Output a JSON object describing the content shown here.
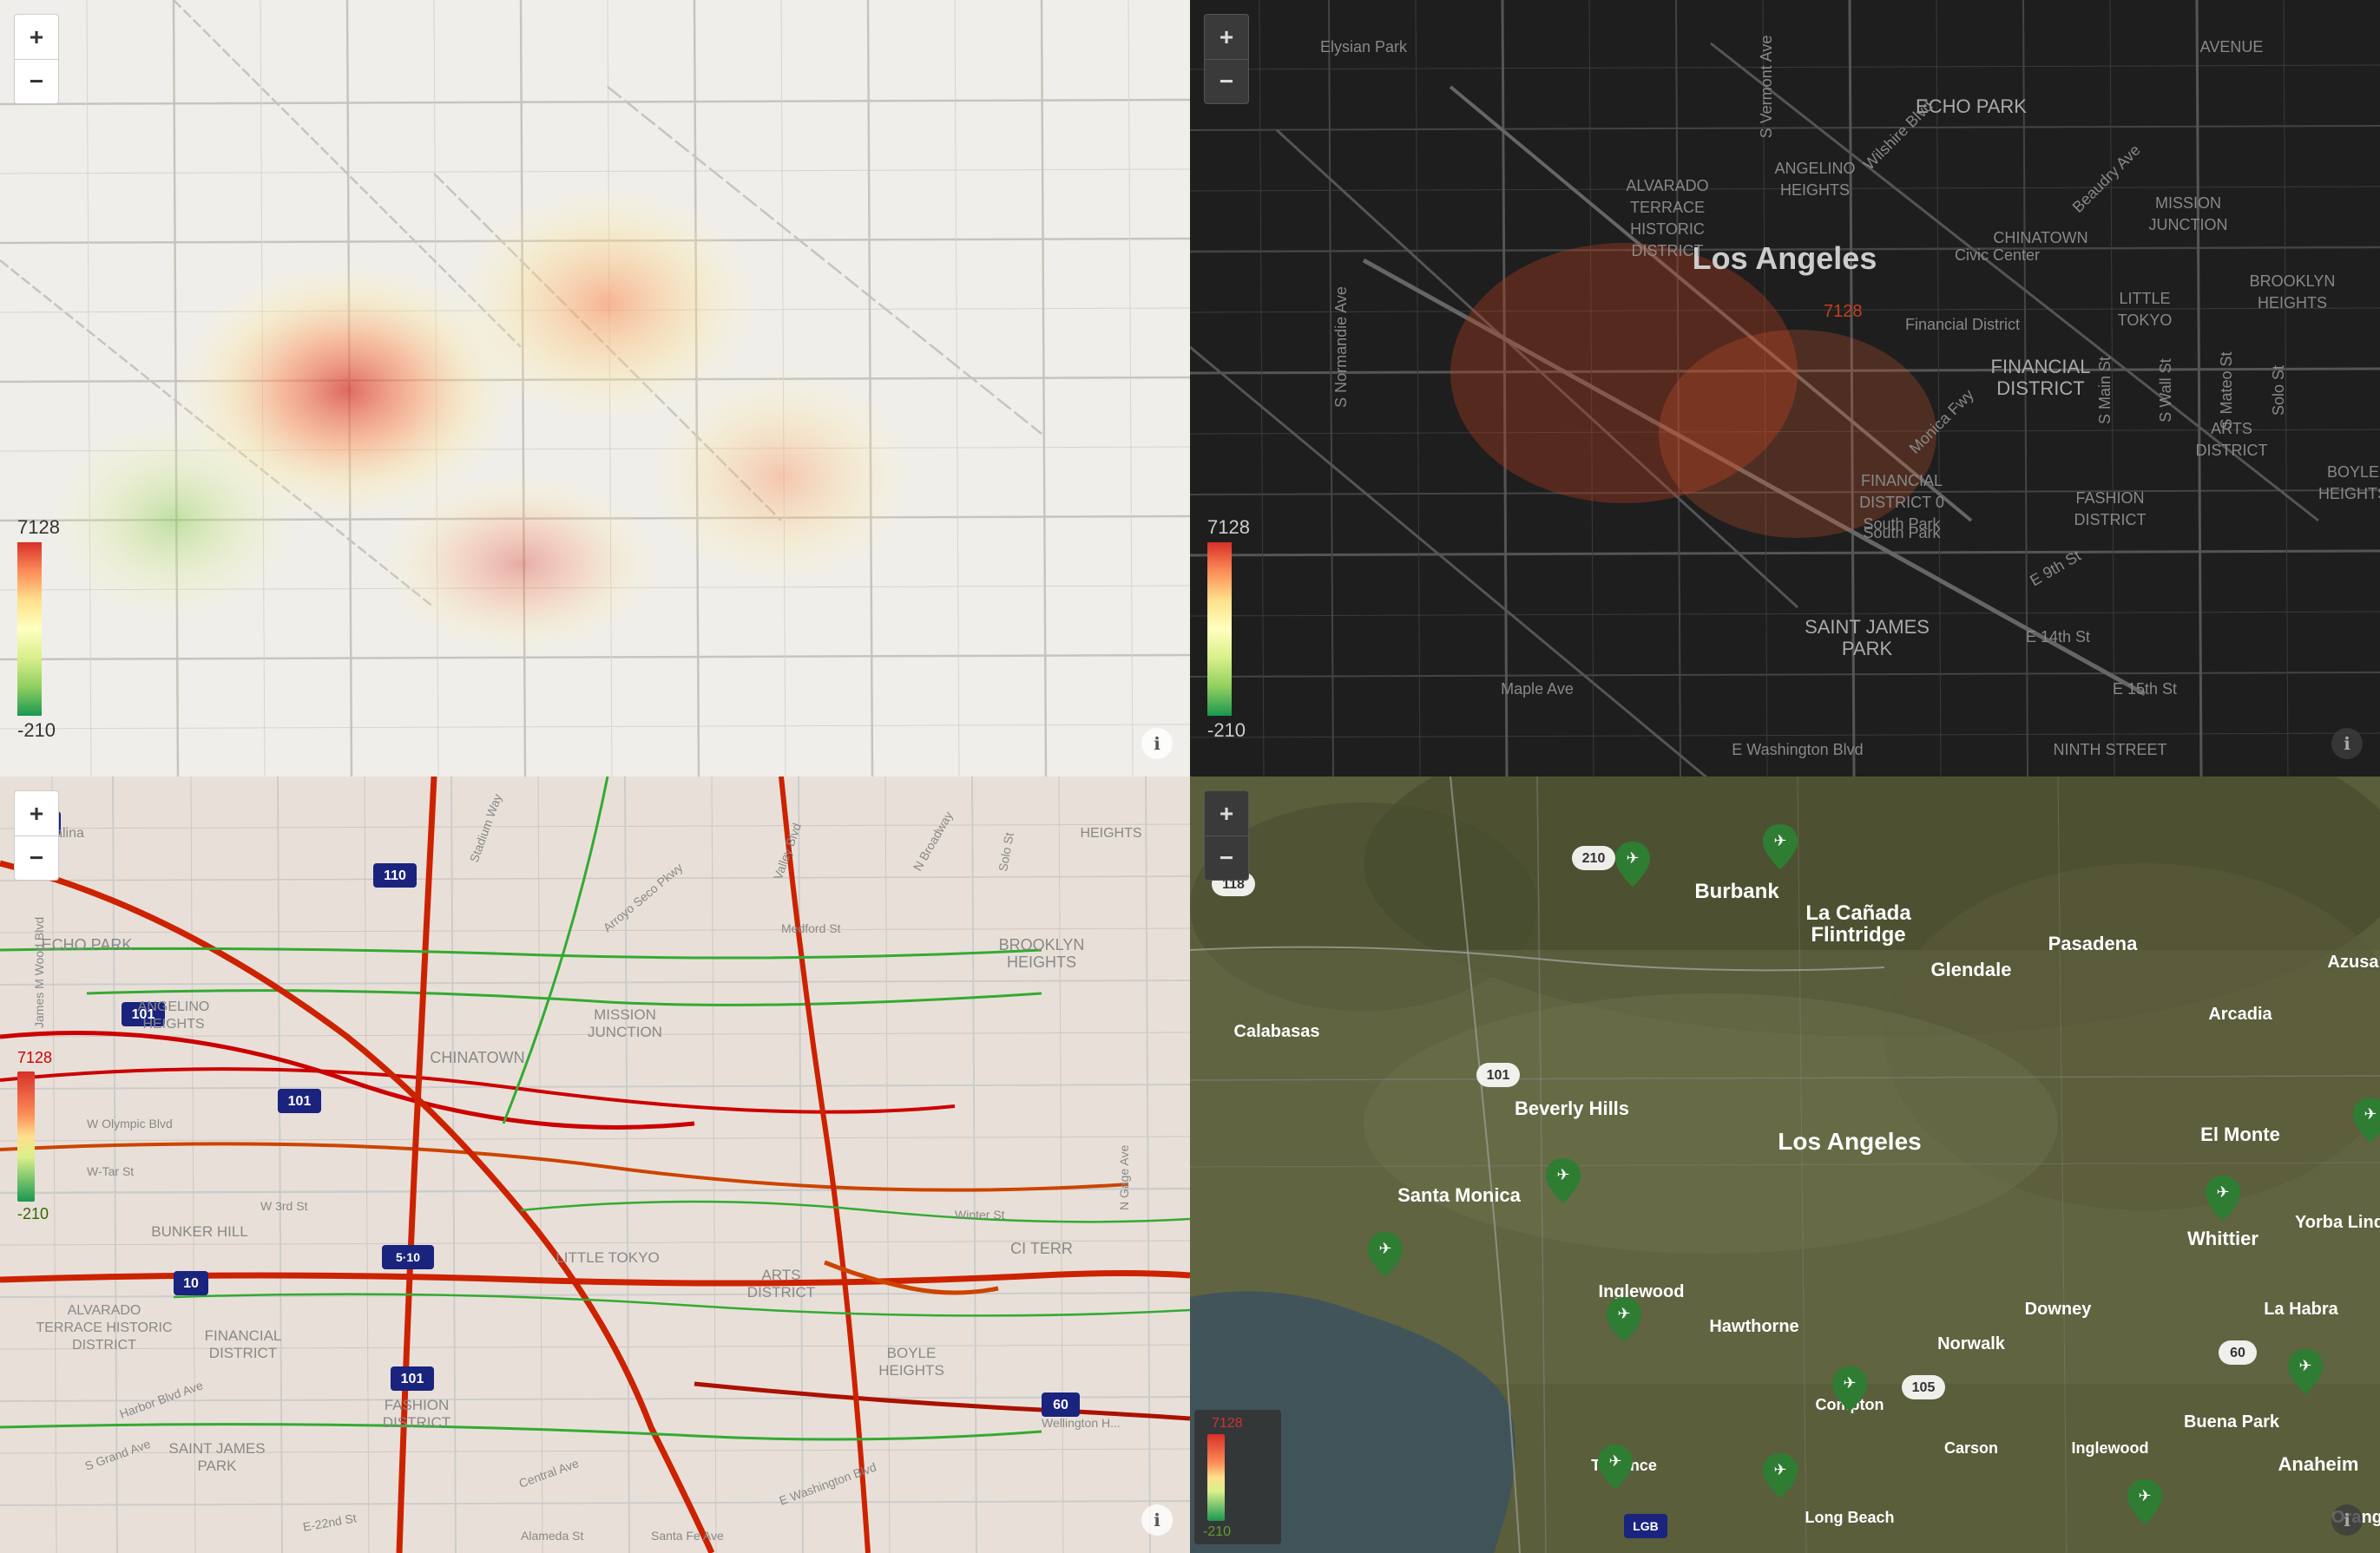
{
  "maps": {
    "top_left": {
      "type": "light_heatmap",
      "zoom_in": "+",
      "zoom_out": "−",
      "legend_max": "7128",
      "legend_min": "-210",
      "info": "ℹ"
    },
    "top_right": {
      "type": "dark_map",
      "zoom_in": "+",
      "zoom_out": "−",
      "legend_max": "7128",
      "legend_min": "-210",
      "info": "ℹ",
      "city_label": "Los Angeles",
      "neighborhoods": [
        "ECHO PARK",
        "ANGELINO HEIGHTS",
        "CHINATOWN",
        "MISSION JUNCTION",
        "LITTLE TOKYO",
        "BROOKLYN HEIGHTS",
        "FINANCIAL DISTRICT",
        "ARTS DISTRICT",
        "FASHION DISTRICT",
        "SAINT JAMES PARK",
        "BOYLE HEIGHTS",
        "Elysian Park",
        "ALVARADO TERRACE HISTORIC DISTRICT"
      ]
    },
    "bottom_left": {
      "type": "street_traffic",
      "zoom_in": "+",
      "zoom_out": "−",
      "legend_max": "7128",
      "legend_min": "-210",
      "info": "ℹ",
      "neighborhoods": [
        "ECHO PARK",
        "ANGELINO HEIGHTS",
        "CHINATOWN",
        "MISSION JUNCTION",
        "BUNKER HILL",
        "LITTLE TOKYO",
        "BROOKLYN HEIGHTS",
        "FINANCIAL DISTRICT",
        "ALVARADO TERRACE HISTORIC DISTRICT",
        "ARTS DISTRICT",
        "FASHION DISTRICT",
        "SAINT JAMES PARK",
        "BOYLE HEIGHTS",
        "HEIGHTS"
      ]
    },
    "bottom_right": {
      "type": "satellite_pins",
      "zoom_in": "+",
      "zoom_out": "−",
      "legend_max": "7128",
      "legend_min": "-210",
      "info": "ℹ",
      "cities": [
        "La Cañada Flintridge",
        "Burbank",
        "Glendale",
        "Pasadena",
        "Arcadia",
        "Azusa",
        "Calabasas",
        "Beverly Hills",
        "El Monte",
        "Los Angeles",
        "Santa Monica",
        "Whittier",
        "Hawthorne",
        "Norwalk",
        "La Habra",
        "Downey",
        "Yorba Linda",
        "Carson",
        "Buena Park",
        "Anaheim",
        "Orange",
        "Compton"
      ],
      "highways": [
        "118",
        "210",
        "101",
        "60",
        "105",
        "LGB"
      ]
    }
  }
}
